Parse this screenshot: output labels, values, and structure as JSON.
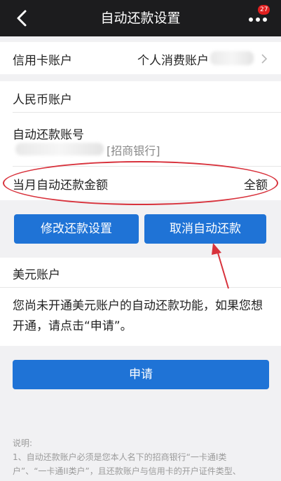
{
  "header": {
    "title": "自动还款设置",
    "badge": "27"
  },
  "card_account": {
    "label": "信用卡账户",
    "value": "个人消费账户"
  },
  "rmb": {
    "section_label": "人民币账户",
    "account_label": "自动还款账号",
    "bank": "[招商银行]",
    "amount_label": "当月自动还款金额",
    "amount_value": "全额"
  },
  "actions": {
    "modify": "修改还款设置",
    "cancel": "取消自动还款"
  },
  "usd": {
    "section_label": "美元账户",
    "message": "您尚未开通美元账户的自动还款功能，如果您想开通，请点击“申请”。",
    "apply": "申请"
  },
  "notes": {
    "title": "说明:",
    "line1": "1、自动还款账户必须是您本人名下的招商银行“一卡通I类",
    "line2": "户”、“一卡通II类户”，且还款账户与信用卡的开户证件类型、"
  },
  "colors": {
    "primary": "#1f73d6",
    "annotation": "#d8323c",
    "nav_bg": "#1c1c1e"
  }
}
